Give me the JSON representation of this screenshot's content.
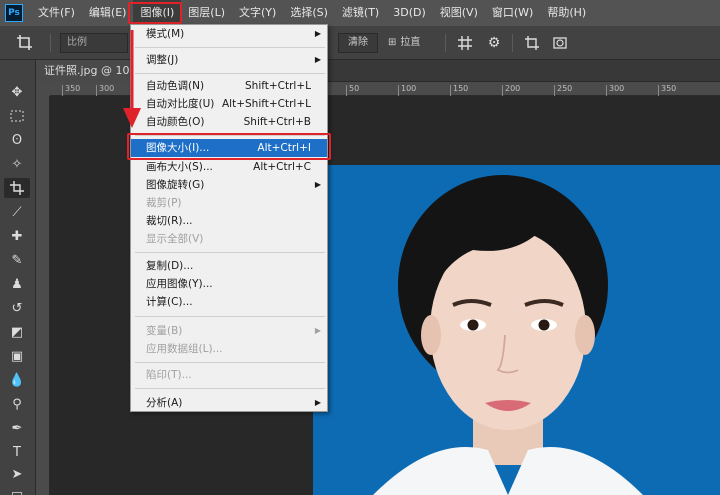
{
  "menubar": {
    "logo": "Ps",
    "items": [
      "文件(F)",
      "编辑(E)",
      "图像(I)",
      "图层(L)",
      "文字(Y)",
      "选择(S)",
      "滤镜(T)",
      "3D(D)",
      "视图(V)",
      "窗口(W)",
      "帮助(H)"
    ]
  },
  "options": {
    "ratio": "比例",
    "clear": "清除",
    "straighten": "拉直"
  },
  "document": {
    "tab_title": "证件照.jpg @ 100"
  },
  "ruler": {
    "ticks": [
      "350",
      "300",
      "250",
      "50",
      "100",
      "150",
      "200",
      "250",
      "300",
      "350"
    ]
  },
  "dropdown": {
    "items": [
      {
        "label": "模式(M)",
        "shortcut": "",
        "submenu": true,
        "disabled": false
      },
      {
        "label": "调整(J)",
        "shortcut": "",
        "submenu": true,
        "disabled": false
      },
      {
        "label": "自动色调(N)",
        "shortcut": "Shift+Ctrl+L",
        "submenu": false,
        "disabled": false
      },
      {
        "label": "自动对比度(U)",
        "shortcut": "Alt+Shift+Ctrl+L",
        "submenu": false,
        "disabled": false
      },
      {
        "label": "自动颜色(O)",
        "shortcut": "Shift+Ctrl+B",
        "submenu": false,
        "disabled": false
      },
      {
        "label": "图像大小(I)...",
        "shortcut": "Alt+Ctrl+I",
        "submenu": false,
        "disabled": false,
        "selected": true
      },
      {
        "label": "画布大小(S)...",
        "shortcut": "Alt+Ctrl+C",
        "submenu": false,
        "disabled": false
      },
      {
        "label": "图像旋转(G)",
        "shortcut": "",
        "submenu": true,
        "disabled": false
      },
      {
        "label": "裁剪(P)",
        "shortcut": "",
        "submenu": false,
        "disabled": true
      },
      {
        "label": "裁切(R)...",
        "shortcut": "",
        "submenu": false,
        "disabled": false
      },
      {
        "label": "显示全部(V)",
        "shortcut": "",
        "submenu": false,
        "disabled": true
      },
      {
        "label": "复制(D)...",
        "shortcut": "",
        "submenu": false,
        "disabled": false
      },
      {
        "label": "应用图像(Y)...",
        "shortcut": "",
        "submenu": false,
        "disabled": false
      },
      {
        "label": "计算(C)...",
        "shortcut": "",
        "submenu": false,
        "disabled": false
      },
      {
        "label": "变量(B)",
        "shortcut": "",
        "submenu": true,
        "disabled": true
      },
      {
        "label": "应用数据组(L)...",
        "shortcut": "",
        "submenu": false,
        "disabled": true
      },
      {
        "label": "陷印(T)...",
        "shortcut": "",
        "submenu": false,
        "disabled": true
      },
      {
        "label": "分析(A)",
        "shortcut": "",
        "submenu": true,
        "disabled": false
      }
    ]
  },
  "colors": {
    "highlight": "#e0222a",
    "selected": "#1e6fc7",
    "photo_bg": "#0d6bb3"
  }
}
